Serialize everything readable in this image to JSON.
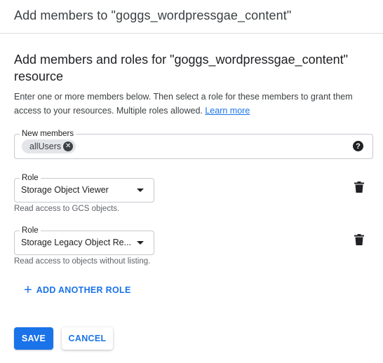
{
  "dialog": {
    "title": "Add members to \"goggs_wordpressgae_content\""
  },
  "section": {
    "heading": "Add members and roles for \"goggs_wordpressgae_content\" resource",
    "intro": "Enter one or more members below. Then select a role for these members to grant them access to your resources. Multiple roles allowed.",
    "learn_more": "Learn more"
  },
  "members": {
    "label": "New members",
    "chips": [
      "allUsers"
    ],
    "help_icon": "help-circle-icon"
  },
  "roles": [
    {
      "label": "Role",
      "value": "Storage Object Viewer",
      "hint": "Read access to GCS objects."
    },
    {
      "label": "Role",
      "value": "Storage Legacy Object Re...",
      "hint": "Read access to objects without listing."
    }
  ],
  "actions": {
    "add_role": "ADD ANOTHER ROLE",
    "save": "SAVE",
    "cancel": "CANCEL"
  },
  "colors": {
    "accent": "#1a73e8",
    "text": "#202124",
    "muted": "#5f6368",
    "border": "#c5c9ce"
  }
}
